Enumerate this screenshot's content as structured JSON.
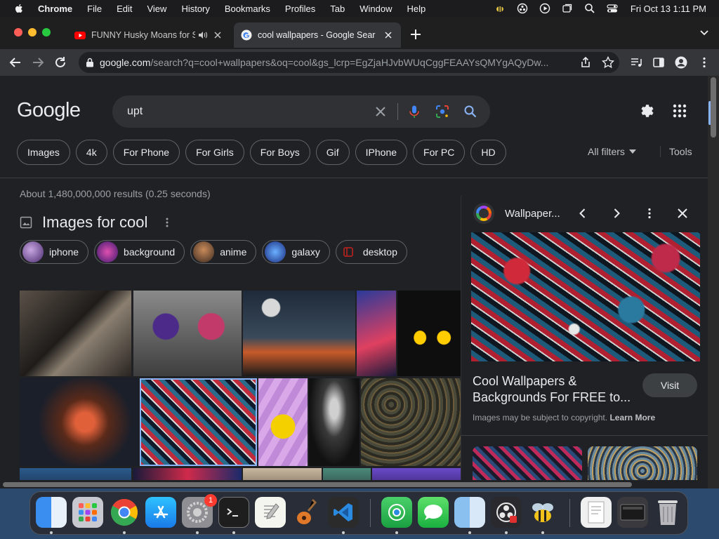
{
  "menubar": {
    "app": "Chrome",
    "items": [
      "File",
      "Edit",
      "View",
      "History",
      "Bookmarks",
      "Profiles",
      "Tab",
      "Window",
      "Help"
    ],
    "clock": "Fri Oct 13  1:11 PM"
  },
  "tabs": [
    {
      "title": "FUNNY Husky Moans for S",
      "active": false
    },
    {
      "title": "cool wallpapers - Google Sear",
      "active": true
    }
  ],
  "omnibox": {
    "host": "google.com",
    "path": "/search?q=cool+wallpapers&oq=cool&gs_lcrp=EgZjaHJvbWUqCggFEAAYsQMYgAQyDw..."
  },
  "google": {
    "logo": "Google",
    "query": "upt",
    "chips": [
      "Images",
      "4k",
      "For Phone",
      "For Girls",
      "For Boys",
      "Gif",
      "IPhone",
      "For PC",
      "HD"
    ],
    "all_filters": "All filters",
    "tools": "Tools",
    "stats": "About 1,480,000,000 results (0.25 seconds)",
    "images_title": "Images for cool",
    "refine": [
      "iphone",
      "background",
      "anime",
      "galaxy",
      "desktop"
    ]
  },
  "panel": {
    "source": "Wallpaper...",
    "title": "Cool Wallpapers & Backgrounds For FREE to...",
    "visit": "Visit",
    "copyright": "Images may be subject to copyright.",
    "learn_more": "Learn More"
  },
  "dock": {
    "badge": "1"
  }
}
